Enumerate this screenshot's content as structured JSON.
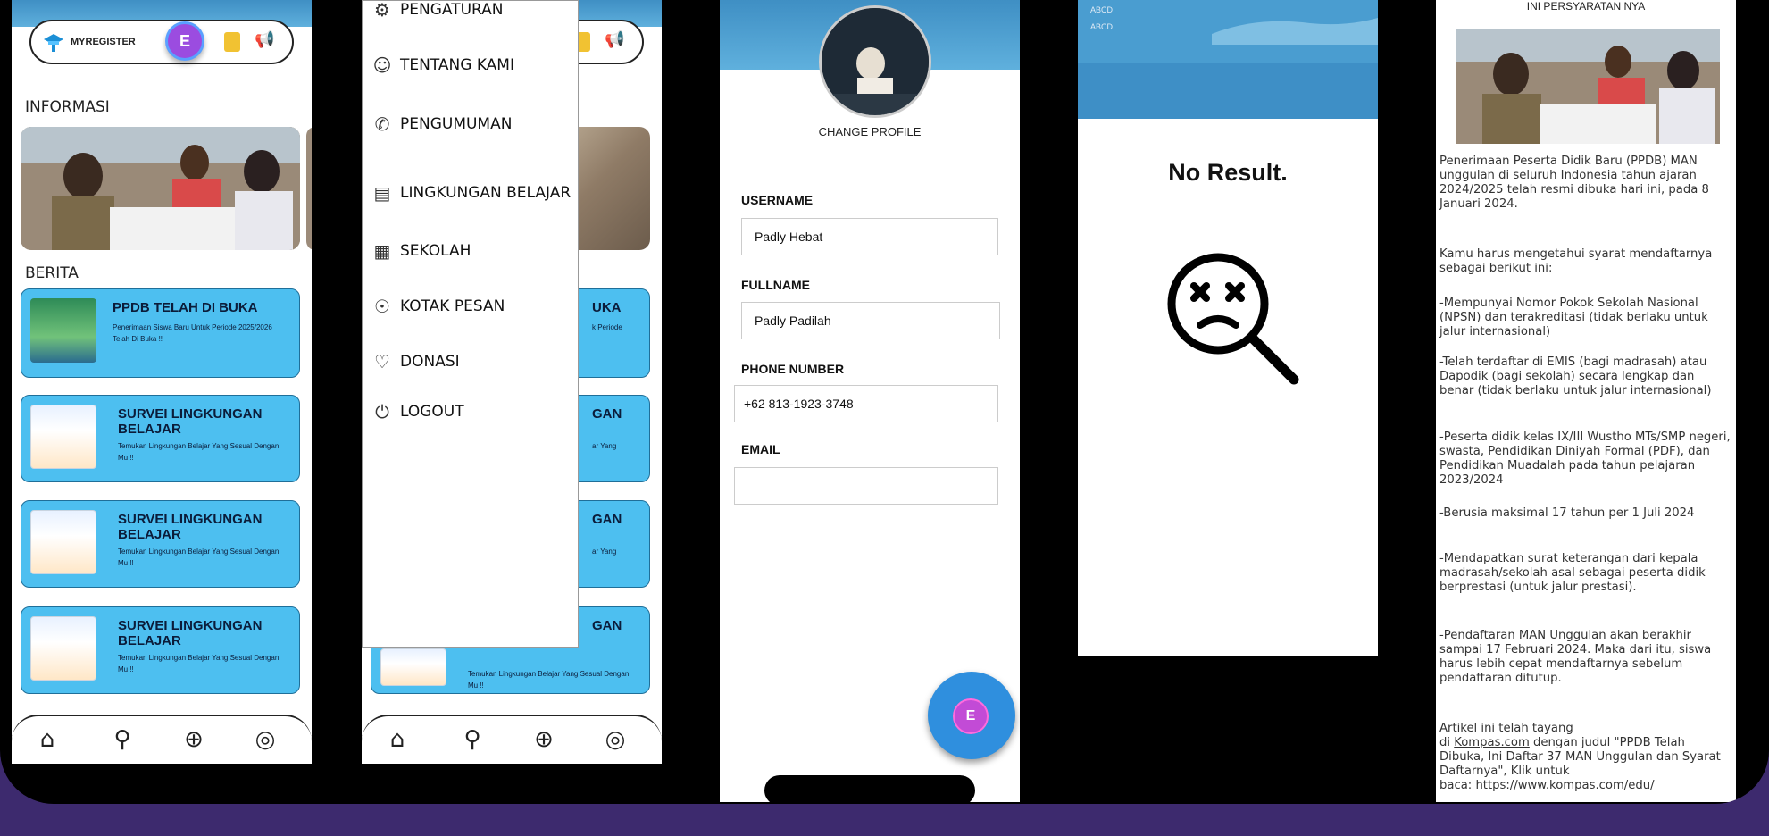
{
  "colors": {
    "background": "#3d2a6e",
    "card_blue": "#4dbff0",
    "accent_purple": "#9b4ce0",
    "fab_blue": "#2f8fde"
  },
  "home": {
    "app_name": "MYREGISTER",
    "avatar_letter": "E",
    "informasi_label": "INFORMASI",
    "berita_label": "BERITA",
    "news": [
      {
        "title": "PPDB TELAH DI BUKA",
        "subtitle": "Penerimaan Siswa Baru Untuk Periode 2025/2026 Telah Di Buka !!"
      },
      {
        "title": "SURVEI LINGKUNGAN BELAJAR",
        "subtitle": "Temukan Lingkungan Belajar Yang Sesual Dengan Mu !!"
      },
      {
        "title": "SURVEI LINGKUNGAN BELAJAR",
        "subtitle": "Temukan Lingkungan Belajar Yang Sesual Dengan Mu !!"
      },
      {
        "title": "SURVEI LINGKUNGAN BELAJAR",
        "subtitle": "Temukan Lingkungan Belajar Yang Sesual Dengan Mu !!"
      }
    ],
    "nav_icons": [
      "home-icon",
      "search-icon",
      "globe-icon",
      "profile-icon"
    ]
  },
  "drawer": {
    "items": [
      {
        "label": "PENGATURAN",
        "icon": "gear-icon"
      },
      {
        "label": "TENTANG KAMI",
        "icon": "people-icon"
      },
      {
        "label": "PENGUMUMAN",
        "icon": "megaphone-icon"
      },
      {
        "label": "LINGKUNGAN BELAJAR",
        "icon": "book-icon"
      },
      {
        "label": "SEKOLAH",
        "icon": "school-icon"
      },
      {
        "label": "KOTAK PESAN",
        "icon": "chat-icon"
      },
      {
        "label": "DONASI",
        "icon": "donation-icon"
      },
      {
        "label": "LOGOUT",
        "icon": "logout-icon"
      }
    ],
    "partial_titles": [
      "UKA",
      "GAN",
      "GAN",
      "GAN"
    ],
    "partial_subs": [
      "k Periode",
      "ar Yang",
      "ar Yang",
      "Temukan Lingkungan Belajar Yang Sesual Dengan Mu !!"
    ]
  },
  "profile": {
    "change_profile": "CHANGE PROFILE",
    "username_label": "USERNAME",
    "username_value": "Padly Hebat",
    "fullname_label": "FULLNAME",
    "fullname_value": "Padly Padilah",
    "phone_label": "PHONE NUMBER",
    "phone_value": "+62 813-1923-3748",
    "email_label": "EMAIL",
    "email_value": "",
    "fab_letter": "E"
  },
  "search": {
    "abcd_1": "ABCD",
    "abcd_2": "ABCD",
    "no_result": "No Result."
  },
  "article": {
    "heading": "INI PERSYARATAN NYA",
    "p1": "Penerimaan Peserta Didik Baru (PPDB) MAN unggulan di seluruh Indonesia tahun ajaran 2024/2025 telah resmi dibuka hari ini, pada 8 Januari 2024.",
    "p2": "Kamu harus mengetahui syarat mendaftarnya sebagai berikut ini:",
    "p3": "-Mempunyai Nomor Pokok Sekolah Nasional (NPSN) dan terakreditasi (tidak berlaku untuk jalur internasional)",
    "p4": "-Telah terdaftar di EMIS (bagi madrasah) atau Dapodik (bagi sekolah) secara lengkap dan benar (tidak berlaku untuk jalur internasional)",
    "p5": "-Peserta didik kelas IX/III Wustho MTs/SMP negeri, swasta, Pendidikan Diniyah Formal (PDF), dan Pendidikan Muadalah pada tahun pelajaran 2023/2024",
    "p6": "-Berusia maksimal 17 tahun per 1 Juli 2024",
    "p7": "-Mendapatkan surat keterangan dari kepala madrasah/sekolah asal sebagai peserta didik berprestasi (untuk jalur prestasi).",
    "p8": "-Pendaftaran MAN Unggulan akan berakhir sampai 17 Februari 2024. Maka dari itu, siswa harus lebih cepat mendaftarnya sebelum pendaftaran ditutup.",
    "p9_a": "Artikel ini telah tayang",
    "p9_b": "di",
    "p9_link": "Kompas.com",
    "p9_c": "dengan judul \"PPDB Telah Dibuka, Ini Daftar 37 MAN Unggulan dan Syarat Daftarnya\", Klik untuk",
    "p9_d": "baca:",
    "p9_url": "https://www.kompas.com/edu/"
  }
}
